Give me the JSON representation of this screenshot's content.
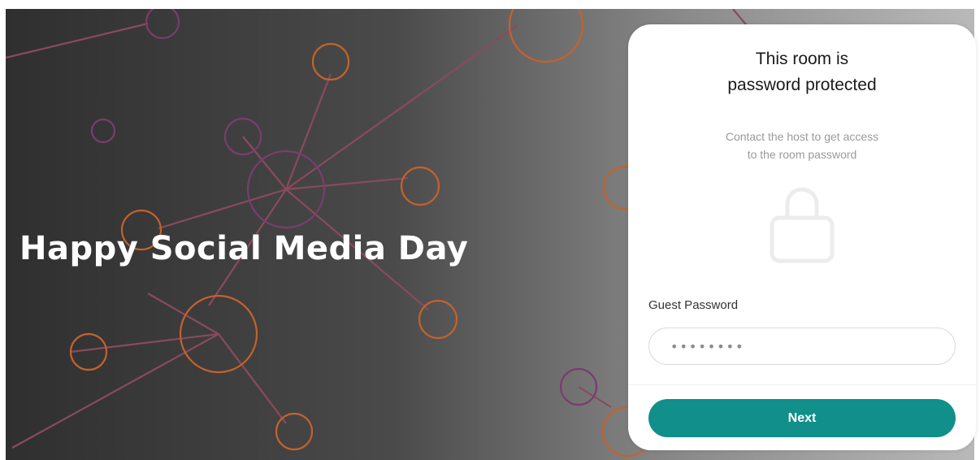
{
  "hero": {
    "title": "Happy Social Media Day"
  },
  "card": {
    "title_line1": "This room is",
    "title_line2": "password protected",
    "subtitle_line1": "Contact the host to get access",
    "subtitle_line2": "to the room password",
    "icon": "lock-icon",
    "password_label": "Guest Password",
    "password_value": "••••••••",
    "next_label": "Next"
  },
  "colors": {
    "accent": "#108f8b",
    "network_orange": "#d06a30",
    "network_purple": "#7a3d6e"
  }
}
